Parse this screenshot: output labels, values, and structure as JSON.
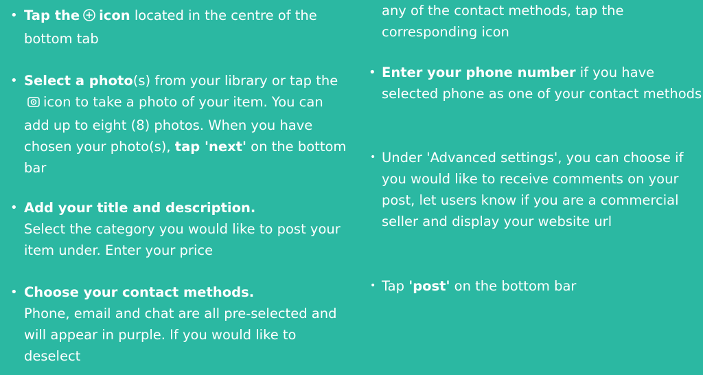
{
  "left": {
    "items": [
      {
        "parts": {
          "a": "Tap the",
          "b": "icon",
          "c": " located in the centre of the bottom tab"
        },
        "icon": "plus-circle-icon"
      },
      {
        "parts": {
          "a": "Select a photo",
          "b": "(s) from your library or tap the",
          "c": "icon to take a photo of your item. You can add up to eight (8) photos. When you have chosen your photo(s), ",
          "d": "tap 'next'",
          "e": " on the bottom bar"
        },
        "icon": "camera-icon"
      },
      {
        "parts": {
          "a": "Add your title and description.",
          "b": "Select the category you would like to post your item under. Enter your price"
        }
      },
      {
        "parts": {
          "a": "Choose your contact methods.",
          "b": "Phone, email and chat are all pre-selected and will appear in purple. If you would like to deselect"
        }
      }
    ]
  },
  "right": {
    "continuation": "any of the contact methods, tap the corresponding icon",
    "items": [
      {
        "parts": {
          "a": "Enter your phone number",
          "b": " if you have selected phone as one of your contact methods"
        }
      },
      {
        "parts": {
          "a": "Under 'Advanced settings', you can choose if you would like to receive comments on your post, let users know if you are a commercial seller and display your website url"
        }
      },
      {
        "parts": {
          "a": "Tap ",
          "b": "'post'",
          "c": " on the bottom bar"
        }
      }
    ]
  },
  "colors": {
    "background": "#2bb8a2",
    "text": "#ffffff"
  }
}
